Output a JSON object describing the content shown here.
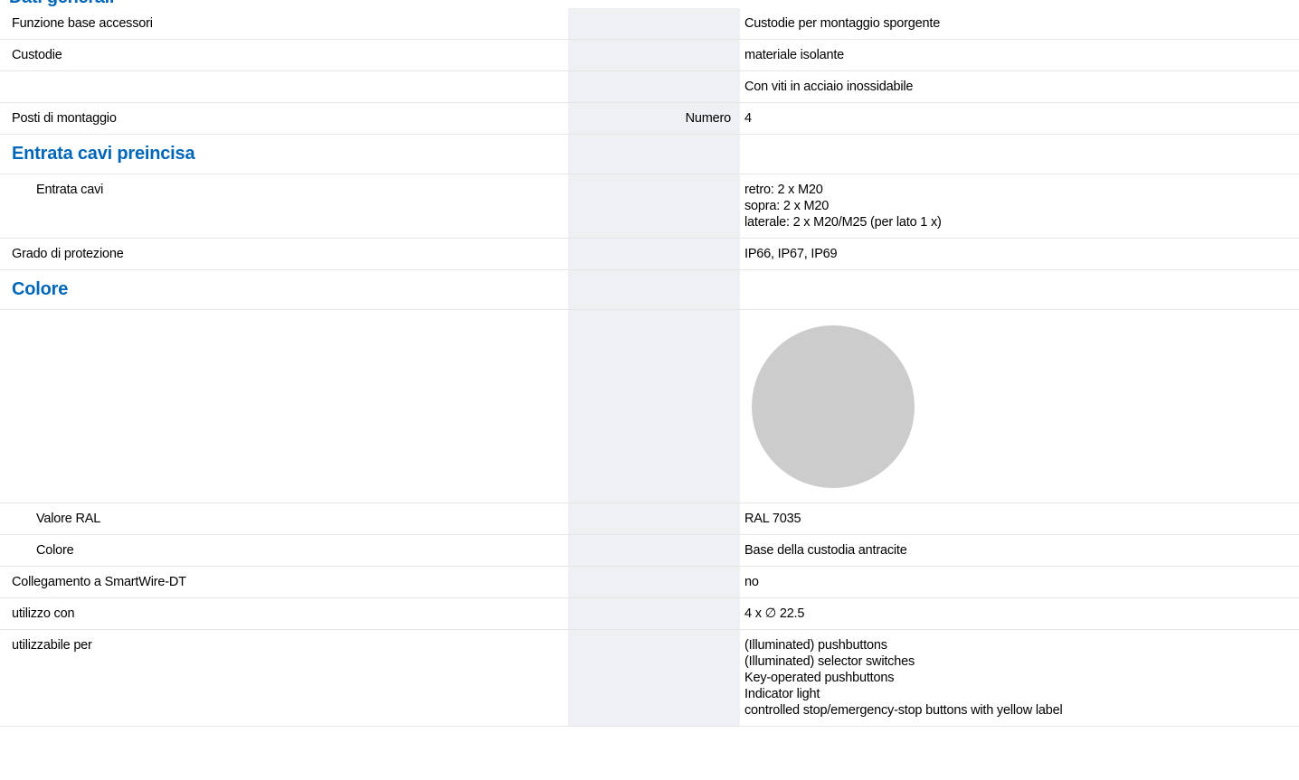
{
  "heading_top": "Dati generali",
  "rows": {
    "funzione": {
      "label": "Funzione base accessori",
      "unit": "",
      "value": [
        "Custodie per montaggio sporgente"
      ]
    },
    "custodie": {
      "label": "Custodie",
      "unit": "",
      "value": [
        "materiale isolante"
      ]
    },
    "viti": {
      "label": "",
      "unit": "",
      "value": [
        "Con viti in acciaio inossidabile"
      ]
    },
    "posti": {
      "label": "Posti di montaggio",
      "unit": "Numero",
      "value": [
        "4"
      ]
    },
    "entrata_section": {
      "label": "Entrata cavi preincisa"
    },
    "entrata": {
      "label": "Entrata cavi",
      "unit": "",
      "value": [
        "retro: 2 x M20",
        "sopra: 2 x M20",
        "laterale: 2 x M20/M25 (per lato 1 x)"
      ]
    },
    "grado": {
      "label": "Grado di protezione",
      "unit": "",
      "value": [
        "IP66, IP67, IP69"
      ]
    },
    "colore_section": {
      "label": "Colore"
    },
    "swatch": {
      "color": "#cccccc",
      "icon": "color-swatch-circle"
    },
    "ral": {
      "label": "Valore RAL",
      "unit": "",
      "value": [
        "RAL 7035"
      ]
    },
    "colore": {
      "label": "Colore",
      "unit": "",
      "value": [
        "Base della custodia antracite"
      ]
    },
    "smartwire": {
      "label": "Collegamento a SmartWire-DT",
      "unit": "",
      "value": [
        "no"
      ]
    },
    "utilizzo": {
      "label": "utilizzo con",
      "unit": "",
      "value": [
        "4 x ∅ 22.5"
      ]
    },
    "utilizzabile": {
      "label": "utilizzabile per",
      "unit": "",
      "value": [
        "(Illuminated) pushbuttons",
        "(Illuminated) selector switches",
        "Key-operated pushbuttons",
        "Indicator light",
        "controlled stop/emergency-stop buttons with yellow label"
      ]
    }
  },
  "colors": {
    "accent": "#0066b8",
    "unit_column_bg": "#eef0f4",
    "row_divider": "#e6e6e6"
  }
}
